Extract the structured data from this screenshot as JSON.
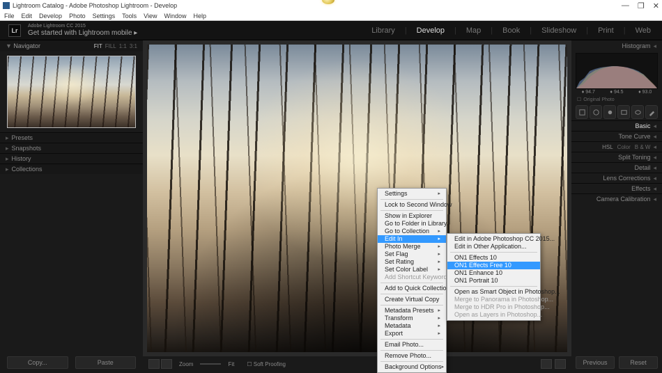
{
  "titlebar": {
    "title": "Lightroom Catalog - Adobe Photoshop Lightroom - Develop"
  },
  "window_controls": {
    "min": "—",
    "max": "❐",
    "close": "✕"
  },
  "menubar": [
    "File",
    "Edit",
    "Develop",
    "Photo",
    "Settings",
    "Tools",
    "View",
    "Window",
    "Help"
  ],
  "identity": {
    "logo": "Lr",
    "line1": "Adobe Lightroom CC 2015",
    "line2": "Get started with Lightroom mobile  ▸"
  },
  "modules": {
    "items": [
      "Library",
      "Develop",
      "Map",
      "Book",
      "Slideshow",
      "Print",
      "Web"
    ],
    "active": "Develop"
  },
  "left": {
    "navigator": {
      "title": "Navigator",
      "fit": "FIT",
      "fill": "FILL",
      "r1": "1:1",
      "r2": "3:1"
    },
    "panels": [
      "Presets",
      "Snapshots",
      "History",
      "Collections"
    ],
    "copy": "Copy...",
    "paste": "Paste"
  },
  "center": {
    "zoom_label": "Zoom",
    "fit": "Fit",
    "soft": "Soft Proofing"
  },
  "right": {
    "histogram": "Histogram",
    "vals": {
      "a": "94.7",
      "b": "94.5",
      "c": "93.0"
    },
    "original": "Original Photo",
    "sections": {
      "basic": "Basic",
      "tone": "Tone Curve",
      "hsl": "HSL",
      "color": "Color",
      "bw": "B & W",
      "split": "Split Toning",
      "detail": "Detail",
      "lens": "Lens Corrections",
      "effects": "Effects",
      "cal": "Camera Calibration"
    },
    "previous": "Previous",
    "reset": "Reset"
  },
  "ctx1": {
    "settings": "Settings",
    "lock": "Lock to Second Window",
    "explorer": "Show in Explorer",
    "folder": "Go to Folder in Library",
    "collection": "Go to Collection",
    "editin": "Edit In",
    "merge": "Photo Merge",
    "flag": "Set Flag",
    "rating": "Set Rating",
    "color": "Set Color Label",
    "shortcut": "Add Shortcut Keyword",
    "quick": "Add to Quick Collection",
    "virtual": "Create Virtual Copy",
    "mpresets": "Metadata Presets",
    "transform": "Transform",
    "metadata": "Metadata",
    "export": "Export",
    "email": "Email Photo...",
    "remove": "Remove Photo...",
    "bg": "Background Options"
  },
  "ctx2": {
    "ps": "Edit in Adobe Photoshop CC 2015...",
    "other": "Edit in Other Application...",
    "on1e": "ON1 Effects 10",
    "on1f": "ON1 Effects Free 10",
    "on1h": "ON1 Enhance 10",
    "on1p": "ON1 Portrait 10",
    "smart": "Open as Smart Object in Photoshop...",
    "pano": "Merge to Panorama in Photoshop...",
    "hdr": "Merge to HDR Pro in Photoshop...",
    "layers": "Open as Layers in Photoshop..."
  }
}
